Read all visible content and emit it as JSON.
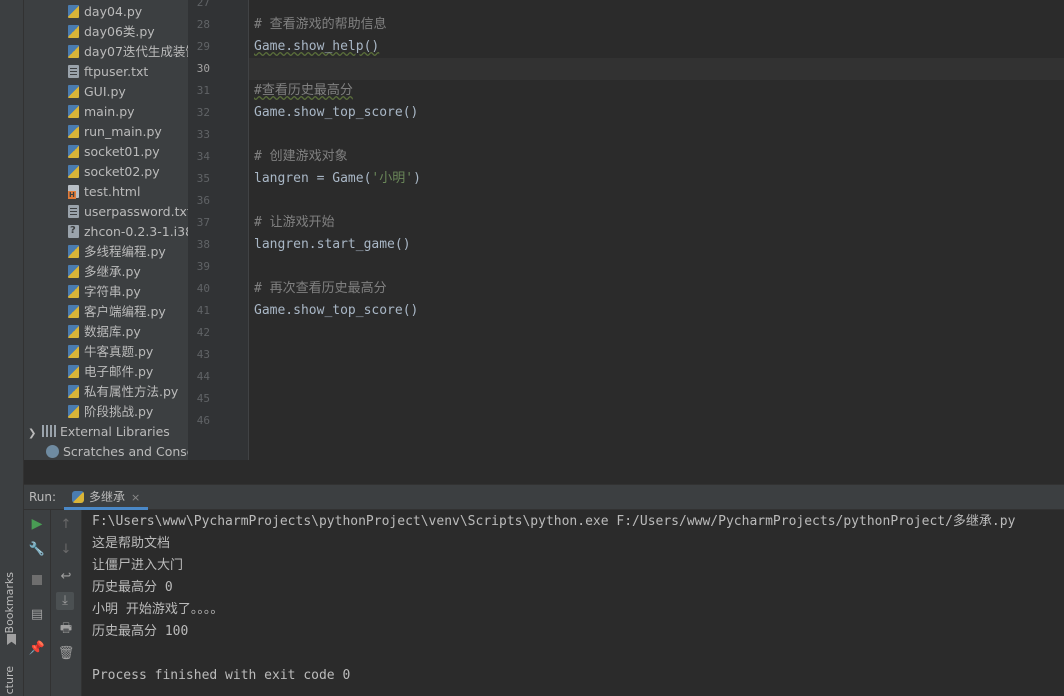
{
  "sidebar_labels": {
    "bookmarks": "Bookmarks",
    "structure": "cture"
  },
  "project_tree": {
    "files": [
      {
        "name": "day04.py",
        "type": "py"
      },
      {
        "name": "day06类.py",
        "type": "py"
      },
      {
        "name": "day07迭代生成装饰",
        "type": "py"
      },
      {
        "name": "ftpuser.txt",
        "type": "txt"
      },
      {
        "name": "GUI.py",
        "type": "py"
      },
      {
        "name": "main.py",
        "type": "py"
      },
      {
        "name": "run_main.py",
        "type": "py"
      },
      {
        "name": "socket01.py",
        "type": "py"
      },
      {
        "name": "socket02.py",
        "type": "py"
      },
      {
        "name": "test.html",
        "type": "html"
      },
      {
        "name": "userpassword.txt",
        "type": "txt"
      },
      {
        "name": "zhcon-0.2.3-1.i386",
        "type": "unk"
      },
      {
        "name": "多线程编程.py",
        "type": "py"
      },
      {
        "name": "多继承.py",
        "type": "py"
      },
      {
        "name": "字符串.py",
        "type": "py"
      },
      {
        "name": "客户端编程.py",
        "type": "py"
      },
      {
        "name": "数据库.py",
        "type": "py"
      },
      {
        "name": "牛客真题.py",
        "type": "py"
      },
      {
        "name": "电子邮件.py",
        "type": "py"
      },
      {
        "name": "私有属性方法.py",
        "type": "py"
      },
      {
        "name": "阶段挑战.py",
        "type": "py"
      }
    ],
    "external_libraries": "External Libraries",
    "scratches": "Scratches and Conso"
  },
  "editor": {
    "current_line": "30",
    "lines": [
      {
        "num": "27",
        "text": ""
      },
      {
        "num": "28",
        "text": "# 查看游戏的帮助信息"
      },
      {
        "num": "29",
        "text": "Game.show_help()"
      },
      {
        "num": "30",
        "text": ""
      },
      {
        "num": "31",
        "text": "#查看历史最高分"
      },
      {
        "num": "32",
        "text": "Game.show_top_score()"
      },
      {
        "num": "33",
        "text": ""
      },
      {
        "num": "34",
        "text": "# 创建游戏对象"
      },
      {
        "num": "35",
        "text_prefix": "langren = Game(",
        "text_string": "'小明'",
        "text_suffix": ")"
      },
      {
        "num": "36",
        "text": ""
      },
      {
        "num": "37",
        "text": "# 让游戏开始"
      },
      {
        "num": "38",
        "text": "langren.start_game()"
      },
      {
        "num": "39",
        "text": ""
      },
      {
        "num": "40",
        "text": "# 再次查看历史最高分"
      },
      {
        "num": "41",
        "text": "Game.show_top_score()"
      },
      {
        "num": "42",
        "text": ""
      },
      {
        "num": "43",
        "text": ""
      },
      {
        "num": "44",
        "text": ""
      },
      {
        "num": "45",
        "text": ""
      },
      {
        "num": "46",
        "text": ""
      }
    ]
  },
  "run_panel": {
    "label": "Run:",
    "tab_name": "多继承",
    "close_glyph": "×",
    "output": [
      "F:\\Users\\www\\PycharmProjects\\pythonProject\\venv\\Scripts\\python.exe F:/Users/www/PycharmProjects/pythonProject/多继承.py",
      "这是帮助文档",
      "让僵尸进入大门",
      "历史最高分 0",
      "小明 开始游戏了。。。。",
      "历史最高分 100",
      "",
      "Process finished with exit code 0"
    ]
  },
  "colors": {
    "accent": "#4a88c7",
    "run_green": "#499c54",
    "comment": "#808080",
    "string": "#6a8759"
  },
  "icons": [
    "run-icon",
    "wrench-icon",
    "stop-icon",
    "layout-icon",
    "pin-icon",
    "up-arrow-icon",
    "down-arrow-icon",
    "soft-wrap-icon",
    "scroll-end-icon",
    "print-icon",
    "trash-icon",
    "python-file-icon",
    "library-icon",
    "scratches-icon"
  ]
}
